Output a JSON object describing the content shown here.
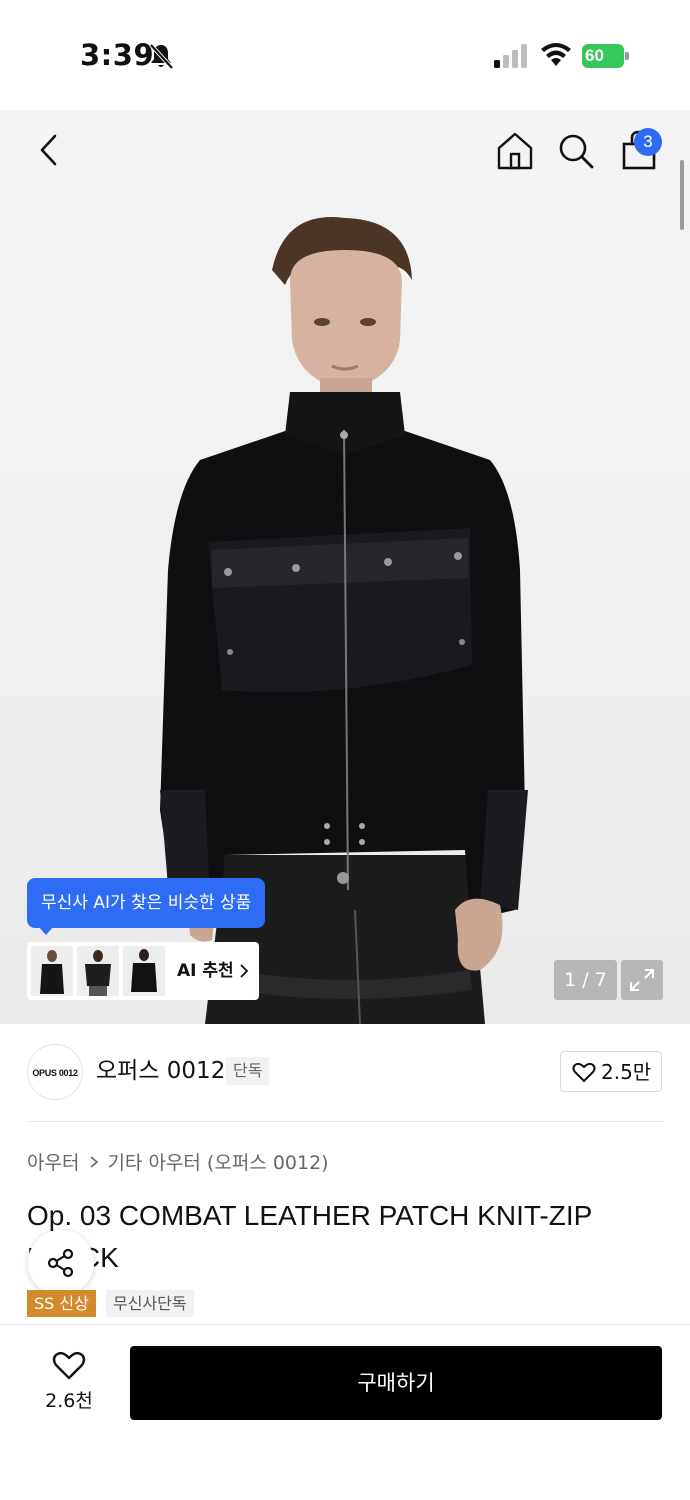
{
  "status_bar": {
    "time": "3:39",
    "battery": "60"
  },
  "gallery": {
    "page_indicator": "1 / 7",
    "ai_tooltip": "무신사 AI가 찾은 비슷한 상품",
    "ai_label": "AI 추천"
  },
  "header": {
    "cart_count": "3"
  },
  "brand": {
    "logo_text": "OPUS 0012",
    "name": "오퍼스 0012",
    "tag": "단독",
    "likes": "2.5만"
  },
  "product": {
    "breadcrumb": [
      "아우터",
      "기타 아우터 (오퍼스 0012)"
    ],
    "title": "Op. 03 COMBAT LEATHER PATCH KNIT-ZIP BLACK",
    "tags": [
      "SS 신상",
      "무신사단독"
    ]
  },
  "bottom_bar": {
    "wish_count": "2.6천",
    "buy_label": "구매하기"
  },
  "colors": {
    "accent_blue": "#2f6cf6",
    "battery_green": "#34c759",
    "new_tag": "#d18a2c",
    "buy_button": "#000000"
  },
  "icons": [
    "bell-off-icon",
    "signal-icon",
    "wifi-icon",
    "back-chevron-icon",
    "home-icon",
    "search-icon",
    "shopping-bag-icon",
    "expand-icon",
    "heart-icon",
    "share-icon",
    "chevron-right-icon"
  ]
}
